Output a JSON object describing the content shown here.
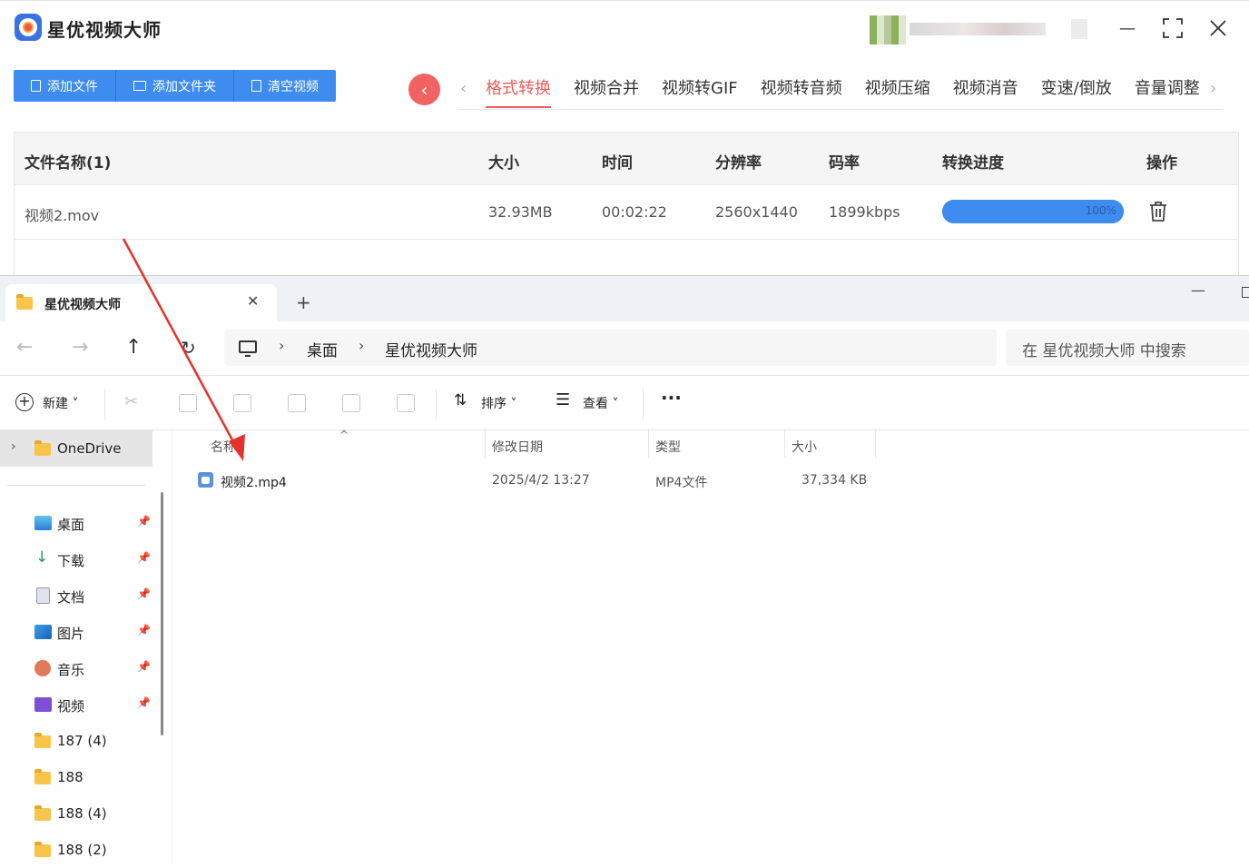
{
  "app": {
    "title": "星优视频大师",
    "toolbar": [
      "添加文件",
      "添加文件夹",
      "清空视频"
    ],
    "tabs": [
      "格式转换",
      "视频合并",
      "视频转GIF",
      "视频转音频",
      "视频压缩",
      "视频消音",
      "变速/倒放",
      "音量调整"
    ],
    "active_tab": 0,
    "table": {
      "headers": [
        "文件名称(1)",
        "大小",
        "时间",
        "分辨率",
        "码率",
        "转换进度",
        "操作"
      ],
      "rows": [
        {
          "name": "视频2.mov",
          "size": "32.93MB",
          "duration": "00:02:22",
          "resolution": "2560x1440",
          "bitrate": "1899kbps",
          "progress_label": "100%",
          "progress": 1.0
        }
      ]
    },
    "colors": {
      "accent": "#3f8cf0",
      "tab_active": "#f05a5a"
    }
  },
  "explorer": {
    "tab_title": "星优视频大师",
    "breadcrumb": [
      "桌面",
      "星优视频大师"
    ],
    "search_placeholder": "在 星优视频大师 中搜索",
    "toolbar": {
      "new": "新建",
      "sort": "排序",
      "view": "查看"
    },
    "sidebar": {
      "onedrive": "OneDrive",
      "quick_access": [
        {
          "label": "桌面",
          "icon": "desktop-icon",
          "pinned": true
        },
        {
          "label": "下载",
          "icon": "download-icon",
          "pinned": true
        },
        {
          "label": "文档",
          "icon": "document-icon",
          "pinned": true
        },
        {
          "label": "图片",
          "icon": "picture-icon",
          "pinned": true
        },
        {
          "label": "音乐",
          "icon": "music-icon",
          "pinned": true
        },
        {
          "label": "视频",
          "icon": "video-icon",
          "pinned": true
        },
        {
          "label": "187 (4)",
          "icon": "folder-icon",
          "pinned": false
        },
        {
          "label": "188",
          "icon": "folder-icon",
          "pinned": false
        },
        {
          "label": "188 (4)",
          "icon": "folder-icon",
          "pinned": false
        },
        {
          "label": "188 (2)",
          "icon": "folder-icon",
          "pinned": false
        }
      ]
    },
    "columns": [
      "名称",
      "修改日期",
      "类型",
      "大小"
    ],
    "files": [
      {
        "name": "视频2.mp4",
        "modified": "2025/4/2 13:27",
        "type": "MP4文件",
        "size": "37,334 KB"
      }
    ]
  }
}
